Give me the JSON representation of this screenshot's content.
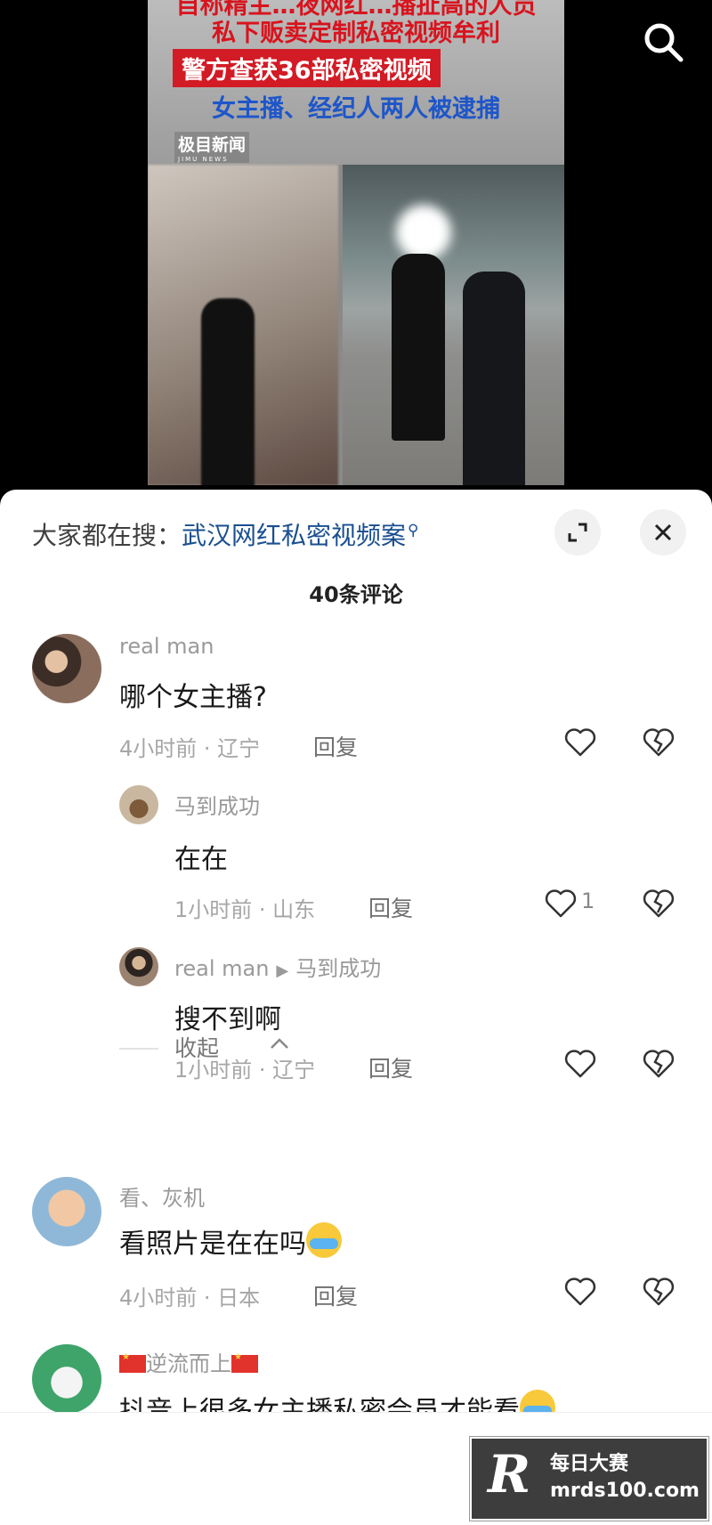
{
  "video": {
    "headlines": [
      "自称精主…夜网红…播扯高的人员",
      "私下贩卖定制私密视频牟利",
      "警方查获36部私密视频",
      "女主播、经纪人两人被逮捕"
    ],
    "source_logo": "极目新闻",
    "source_logo_en": "JIMU NEWS"
  },
  "panel": {
    "trending_prefix": "大家都在搜：",
    "trending_query": "武汉网红私密视频案",
    "comment_count": "40条评论"
  },
  "comments": [
    {
      "author": "real man",
      "text": "哪个女主播?",
      "meta": "4小时前 · 辽宁",
      "reply": "回复",
      "likes": ""
    },
    {
      "author": "马到成功",
      "text": "在在",
      "meta": "1小时前 · 山东",
      "reply": "回复",
      "likes": "1"
    },
    {
      "author": "real man",
      "reply_to": "马到成功",
      "text": "搜不到啊",
      "meta": "1小时前 · 辽宁",
      "reply": "回复",
      "likes": ""
    },
    {
      "author": "看、灰机",
      "text": "看照片是在在吗",
      "meta": "4小时前 · 日本",
      "reply": "回复",
      "likes": ""
    },
    {
      "author": "逆流而上",
      "text": "抖音上很多女主播私密会员才能看",
      "meta": "",
      "reply": "",
      "likes": ""
    }
  ],
  "collapse_label": "收起",
  "watermark": {
    "cn": "每日大赛",
    "url": "mrds100.com",
    "letter": "R"
  },
  "icons": {
    "search": "search-icon",
    "expand": "expand-icon",
    "close": "close-icon",
    "like": "heart-icon",
    "dislike": "broken-heart-icon",
    "collapse": "chevron-up-icon",
    "flag": "china-flag-icon",
    "emoji": "laughing-tears-emoji"
  },
  "colors": {
    "link": "#1a4f8f",
    "headline_red": "#d8141e",
    "headline_blue": "#1e56c9"
  }
}
